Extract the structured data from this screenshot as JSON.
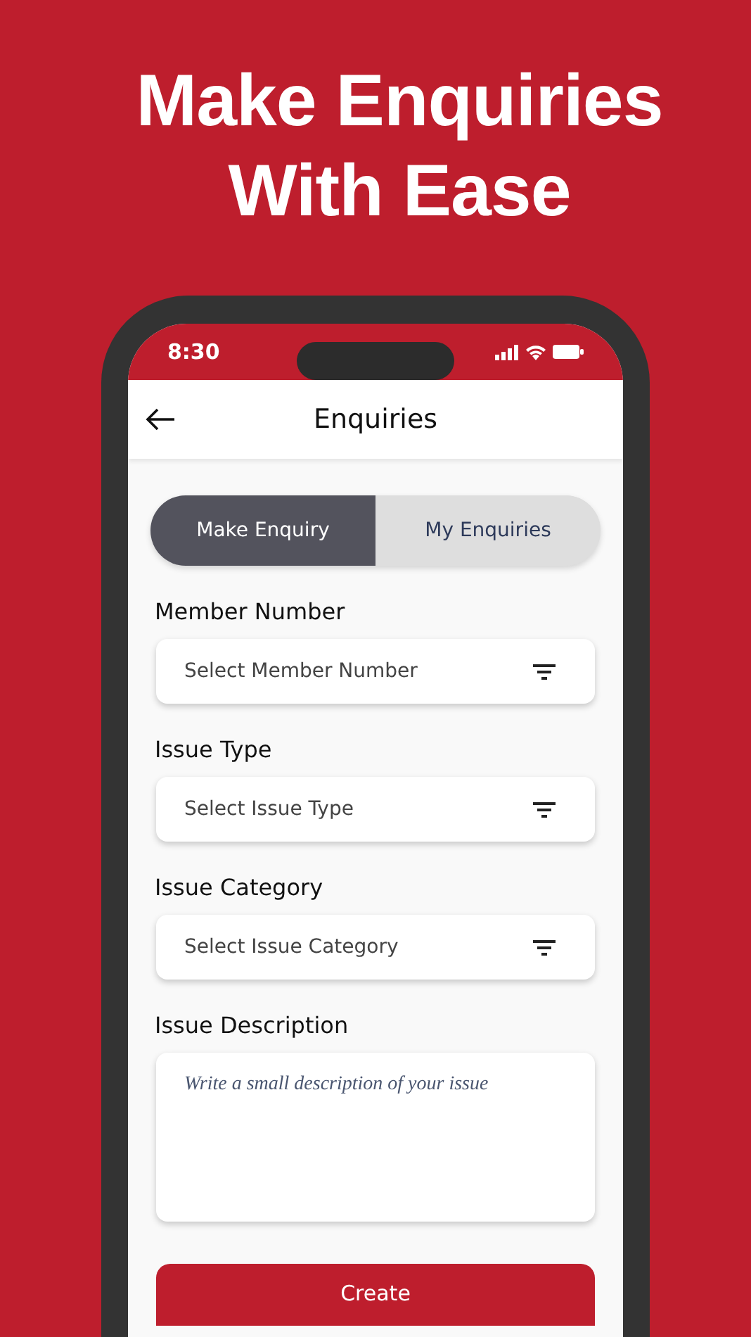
{
  "headline": [
    "Make Enquiries",
    "With Ease"
  ],
  "status_bar": {
    "time": "8:30"
  },
  "header": {
    "title": "Enquiries"
  },
  "tabs": [
    {
      "label": "Make Enquiry",
      "selected": true
    },
    {
      "label": "My Enquiries",
      "selected": false
    }
  ],
  "fields": [
    {
      "kind": "select",
      "label": "Member Number",
      "placeholder": "Select Member Number"
    },
    {
      "kind": "select",
      "label": "Issue Type",
      "placeholder": "Select Issue Type"
    },
    {
      "kind": "select",
      "label": "Issue Category",
      "placeholder": "Select Issue Category"
    },
    {
      "kind": "textarea",
      "label": "Issue Description",
      "placeholder": "Write a small description of your issue"
    }
  ],
  "submit_button": "Create"
}
